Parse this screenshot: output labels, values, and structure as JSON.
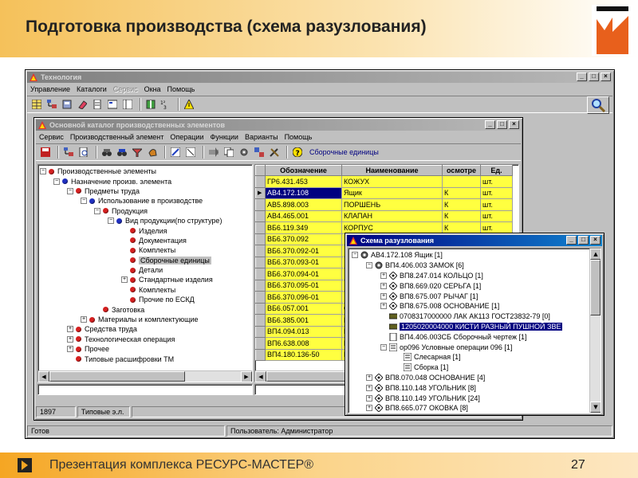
{
  "slide": {
    "title": "Подготовка производства (схема разузлования)",
    "footer_text": "Презентация комплекса РЕСУРС-МАСТЕР®",
    "page_number": "27",
    "accent_color": "#f5a623"
  },
  "app_window": {
    "title": "Технология",
    "menu": [
      "Управление",
      "Каталоги",
      "Сервис",
      "Окна",
      "Помощь"
    ],
    "menu_disabled": [
      false,
      false,
      true,
      false,
      false
    ],
    "status": {
      "left": "Готов",
      "user": "Пользователь: Администратор"
    }
  },
  "catalog_window": {
    "title": "Основной каталог производственных элементов",
    "menu": [
      "Сервис",
      "Производственный элемент",
      "Операции",
      "Функции",
      "Варианты",
      "Помощь"
    ],
    "toolbar_label": "Сборочные единицы",
    "tree": [
      {
        "label": "Производственные элементы",
        "level": 0,
        "exp": "−",
        "color": "#d42020"
      },
      {
        "label": "Назначение произв. элемента",
        "level": 1,
        "exp": "−",
        "color": "#2030c0"
      },
      {
        "label": "Предметы труда",
        "level": 2,
        "exp": "−",
        "color": "#d42020"
      },
      {
        "label": "Использование в производстве",
        "level": 3,
        "exp": "−",
        "color": "#2030c0"
      },
      {
        "label": "Продукция",
        "level": 4,
        "exp": "−",
        "color": "#d42020"
      },
      {
        "label": "Вид продукции(по структуре)",
        "level": 5,
        "exp": "−",
        "color": "#2030c0"
      },
      {
        "label": "Изделия",
        "level": 6,
        "exp": "",
        "color": "#d42020"
      },
      {
        "label": "Документация",
        "level": 6,
        "exp": "",
        "color": "#d42020"
      },
      {
        "label": "Комплекты",
        "level": 6,
        "exp": "",
        "color": "#d42020"
      },
      {
        "label": "Сборочные единицы",
        "level": 6,
        "exp": "",
        "color": "#d42020",
        "selected": true
      },
      {
        "label": "Детали",
        "level": 6,
        "exp": "",
        "color": "#d42020"
      },
      {
        "label": "Стандартные изделия",
        "level": 6,
        "exp": "+",
        "color": "#d42020"
      },
      {
        "label": "Комплекты",
        "level": 6,
        "exp": "",
        "color": "#d42020"
      },
      {
        "label": "Прочие по ЕСКД",
        "level": 6,
        "exp": "",
        "color": "#d42020"
      },
      {
        "label": "Заготовка",
        "level": 4,
        "exp": "",
        "color": "#d42020"
      },
      {
        "label": "Материалы и комплектующие",
        "level": 3,
        "exp": "+",
        "color": "#d42020"
      },
      {
        "label": "Средства труда",
        "level": 2,
        "exp": "+",
        "color": "#d42020"
      },
      {
        "label": "Технологическая операция",
        "level": 2,
        "exp": "+",
        "color": "#d42020"
      },
      {
        "label": "Прочее",
        "level": 2,
        "exp": "+",
        "color": "#d42020"
      },
      {
        "label": "Типовые расшифровки ТМ",
        "level": 2,
        "exp": "",
        "color": "#d42020"
      }
    ],
    "table": {
      "headers": [
        "Обозначение",
        "Наименование",
        "осмотре",
        "Ед."
      ],
      "rows": [
        [
          "ГР6.431.453",
          "КОЖУХ",
          "",
          "шт."
        ],
        [
          "АВ4.172.108",
          "Ящик",
          "К",
          "шт."
        ],
        [
          "АВ5.898.003",
          "ПОРШЕНЬ",
          "К",
          "шт."
        ],
        [
          "АВ4.465.001",
          "КЛАПАН",
          "К",
          "шт."
        ],
        [
          "ВБ6.119.349",
          "КОРПУС",
          "К",
          "шт."
        ],
        [
          "ВБ6.370.092",
          "",
          "",
          ""
        ],
        [
          "ВБ6.370.092-01",
          "",
          "",
          ""
        ],
        [
          "ВБ6.370.093-01",
          "",
          "",
          ""
        ],
        [
          "ВБ6.370.094-01",
          "",
          "",
          ""
        ],
        [
          "ВБ6.370.095-01",
          "",
          "",
          ""
        ],
        [
          "ВБ6.370.096-01",
          "",
          "",
          ""
        ],
        [
          "ВБ6.057.001",
          "",
          "",
          ""
        ],
        [
          "ВБ6.385.001",
          "",
          "",
          ""
        ],
        [
          "ВП4.094.013",
          "",
          "",
          ""
        ],
        [
          "ВП6.638.008",
          "",
          "",
          ""
        ],
        [
          "ВП4.180.136-50",
          "",
          "",
          ""
        ]
      ],
      "first_col_cut": [
        "",
        "",
        "",
        "",
        "",
        "",
        "",
        "",
        "",
        "",
        "",
        "С",
        "П",
        "Г",
        "Г",
        "Г"
      ],
      "selected_row": 1
    },
    "status": {
      "count": "1897",
      "type": "Типовые э.л."
    }
  },
  "scheme_window": {
    "title": "Схема разузлования",
    "rows": [
      {
        "text": "АВ4.172.108 Ящик [1]",
        "indent": 0,
        "exp": "−",
        "icon": "gear"
      },
      {
        "text": "ВП4.406.003 ЗАМОК [6]",
        "indent": 1,
        "exp": "−",
        "icon": "gear"
      },
      {
        "text": "ВП8.247.014 КОЛЬЦО [1]",
        "indent": 2,
        "exp": "+",
        "icon": "diamond"
      },
      {
        "text": "ВП8.669.020 СЕРЬГА [1]",
        "indent": 2,
        "exp": "+",
        "icon": "diamond"
      },
      {
        "text": "ВП8.675.007 РЫЧАГ [1]",
        "indent": 2,
        "exp": "+",
        "icon": "diamond"
      },
      {
        "text": "ВП8.675.008 ОСНОВАНИЕ [1]",
        "indent": 2,
        "exp": "+",
        "icon": "diamond"
      },
      {
        "text": "0708317000000 ЛАК АК113 ГОСТ23832-79 [0]",
        "indent": 2,
        "exp": "",
        "icon": "material"
      },
      {
        "text": "1205020004000 КИСТИ РАЗНЫЙ ПУШНОЙ ЗВЕ",
        "indent": 2,
        "exp": "",
        "icon": "material",
        "highlight": true
      },
      {
        "text": "ВП4.406.003СБ Сборочный чертеж [1]",
        "indent": 2,
        "exp": "",
        "icon": "doc"
      },
      {
        "text": "ор096 Условные операции 096 [1]",
        "indent": 2,
        "exp": "−",
        "icon": "op"
      },
      {
        "text": "Слесарная       [1]",
        "indent": 3,
        "exp": "",
        "icon": "op"
      },
      {
        "text": "Сборка       [1]",
        "indent": 3,
        "exp": "",
        "icon": "op"
      },
      {
        "text": "ВП8.070.048 ОСНОВАНИЕ [4]",
        "indent": 1,
        "exp": "+",
        "icon": "diamond"
      },
      {
        "text": "ВП8.110.148 УГОЛЬНИК [8]",
        "indent": 1,
        "exp": "+",
        "icon": "diamond"
      },
      {
        "text": "ВП8.110.149 УГОЛЬНИК [24]",
        "indent": 1,
        "exp": "+",
        "icon": "diamond"
      },
      {
        "text": "ВП8.665.077 ОКОВКА [8]",
        "indent": 1,
        "exp": "+",
        "icon": "diamond"
      }
    ]
  }
}
